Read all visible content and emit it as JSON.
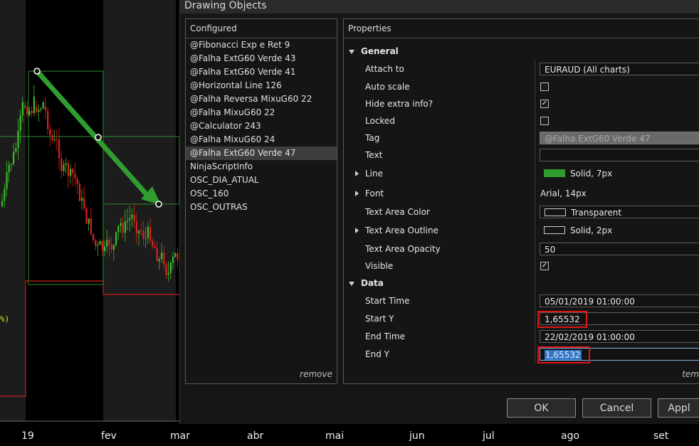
{
  "chart": {
    "x_axis_labels": [
      "19",
      "fev",
      "mar",
      "abr",
      "mai",
      "jun",
      "jul",
      "ago",
      "set"
    ],
    "partial_text": "%)",
    "colors": {
      "up": "#3bbf2a",
      "down": "#e02020",
      "arrow": "#2f9e2f",
      "box": "#2e8b2e",
      "line": "#d01a1a"
    }
  },
  "dialog": {
    "title": "Drawing Objects",
    "configured": {
      "header": "Configured",
      "items": [
        "@Fibonacci Exp e Ret 9",
        "@Falha ExtG60 Verde 43",
        "@Falha ExtG60 Verde 41",
        "@Horizontal Line 126",
        "@Falha Reversa MixuG60 22",
        "@Falha MixuG60 22",
        "@Calculator 243",
        "@Falha MixuG60 24",
        "@Falha ExtG60 Verde 47",
        "NinjaScriptInfo",
        "OSC_DIA_ATUAL",
        "OSC_160",
        "OSC_OUTRAS"
      ],
      "selected_index": 8,
      "remove_label": "remove"
    },
    "properties": {
      "header": "Properties",
      "general_label": "General",
      "attach_to_label": "Attach to",
      "attach_to_value": "EURAUD (All charts)",
      "auto_scale_label": "Auto scale",
      "hide_extra_label": "Hide extra info?",
      "hide_extra_check": "✓",
      "locked_label": "Locked",
      "tag_label": "Tag",
      "tag_value": "@Falha ExtG60 Verde 47",
      "text_label": "Text",
      "text_value": "",
      "line_label": "Line",
      "line_value": "Solid, 7px",
      "line_color": "#2f9e2f",
      "font_label": "Font",
      "font_value": "Arial, 14px",
      "text_area_color_label": "Text Area Color",
      "text_area_color_value": "Transparent",
      "text_area_outline_label": "Text Area Outline",
      "text_area_outline_value": "Solid, 2px",
      "text_area_opacity_label": "Text Area Opacity",
      "text_area_opacity_value": "50",
      "visible_label": "Visible",
      "visible_check": "✓",
      "data_label": "Data",
      "start_time_label": "Start Time",
      "start_time_value": "05/01/2019 01:00:00",
      "start_y_label": "Start Y",
      "start_y_value": "1,65532",
      "end_time_label": "End Time",
      "end_time_value": "22/02/2019 01:00:00",
      "end_y_label": "End Y",
      "end_y_value": "1,65532",
      "footer_partial": "tem"
    },
    "buttons": {
      "ok": "OK",
      "cancel": "Cancel",
      "apply": "Appl"
    }
  }
}
